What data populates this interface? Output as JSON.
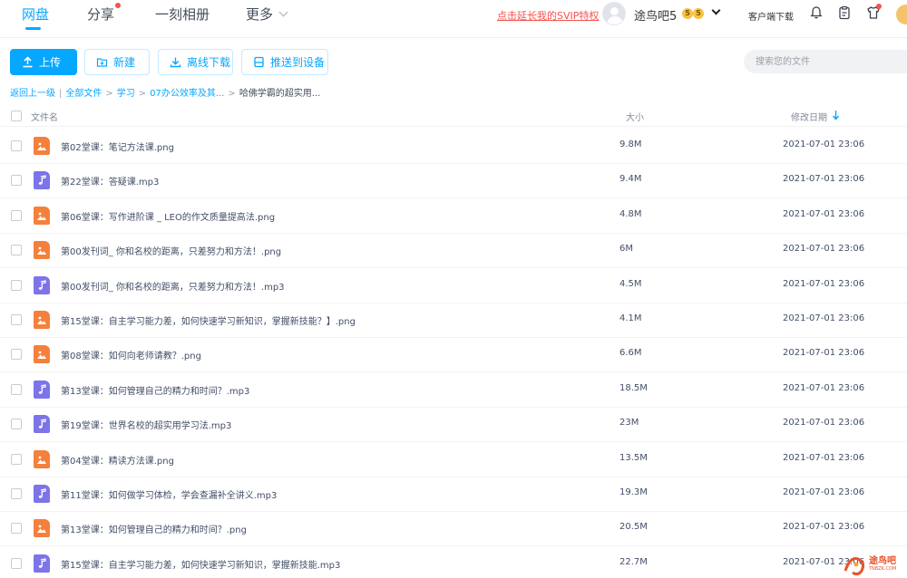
{
  "nav": {
    "items": [
      "网盘",
      "分享",
      "一刻相册",
      "更多"
    ],
    "svip_link": "点击延长我的SVIP特权",
    "username": "途鸟吧5",
    "badges": [
      "5",
      "5"
    ],
    "client_download": "客户端下载"
  },
  "toolbar": {
    "upload": "上传",
    "new": "新建",
    "offline_download": "离线下载",
    "push_to_device": "推送到设备",
    "search_placeholder": "搜索您的文件"
  },
  "breadcrumb": [
    "返回上一级",
    "全部文件",
    "学习",
    "07办公效率及其...",
    "哈佛学霸的超实用..."
  ],
  "table": {
    "col_name": "文件名",
    "col_size": "大小",
    "col_date": "修改日期",
    "rows": [
      {
        "name": "第02堂课：笔记方法课.png",
        "type": "png",
        "size": "9.8M",
        "date": "2021-07-01 23:06"
      },
      {
        "name": "第22堂课：答疑课.mp3",
        "type": "mp3",
        "size": "9.4M",
        "date": "2021-07-01 23:06"
      },
      {
        "name": "第06堂课：写作进阶课 _ LEO的作文质量提高法.png",
        "type": "png",
        "size": "4.8M",
        "date": "2021-07-01 23:06"
      },
      {
        "name": "第00发刊词_ 你和名校的距离，只差努力和方法！.png",
        "type": "png",
        "size": "6M",
        "date": "2021-07-01 23:06"
      },
      {
        "name": "第00发刊词_ 你和名校的距离，只差努力和方法！.mp3",
        "type": "mp3",
        "size": "4.5M",
        "date": "2021-07-01 23:06"
      },
      {
        "name": "第15堂课：自主学习能力差，如何快速学习新知识，掌握新技能？】.png",
        "type": "png",
        "size": "4.1M",
        "date": "2021-07-01 23:06"
      },
      {
        "name": "第08堂课：如何向老师请教？.png",
        "type": "png",
        "size": "6.6M",
        "date": "2021-07-01 23:06"
      },
      {
        "name": "第13堂课：如何管理自己的精力和时间？.mp3",
        "type": "mp3",
        "size": "18.5M",
        "date": "2021-07-01 23:06"
      },
      {
        "name": "第19堂课：世界名校的超实用学习法.mp3",
        "type": "mp3",
        "size": "23M",
        "date": "2021-07-01 23:06"
      },
      {
        "name": "第04堂课：精读方法课.png",
        "type": "png",
        "size": "13.5M",
        "date": "2021-07-01 23:06"
      },
      {
        "name": "第11堂课：如何做学习体检，学会查漏补全讲义.mp3",
        "type": "mp3",
        "size": "19.3M",
        "date": "2021-07-01 23:06"
      },
      {
        "name": "第13堂课：如何管理自己的精力和时间？.png",
        "type": "png",
        "size": "20.5M",
        "date": "2021-07-01 23:06"
      },
      {
        "name": "第15堂课：自主学习能力差，如何快速学习新知识，掌握新技能.mp3",
        "type": "mp3",
        "size": "22.7M",
        "date": "2021-07-01 23:06"
      }
    ]
  },
  "watermark": {
    "text": "途鸟吧",
    "sub": "TNBZK.COM"
  },
  "colors": {
    "accent": "#06a7ff",
    "png_icon": "#f5803b",
    "mp3_icon": "#7c74e8",
    "svip": "#f5534f"
  }
}
